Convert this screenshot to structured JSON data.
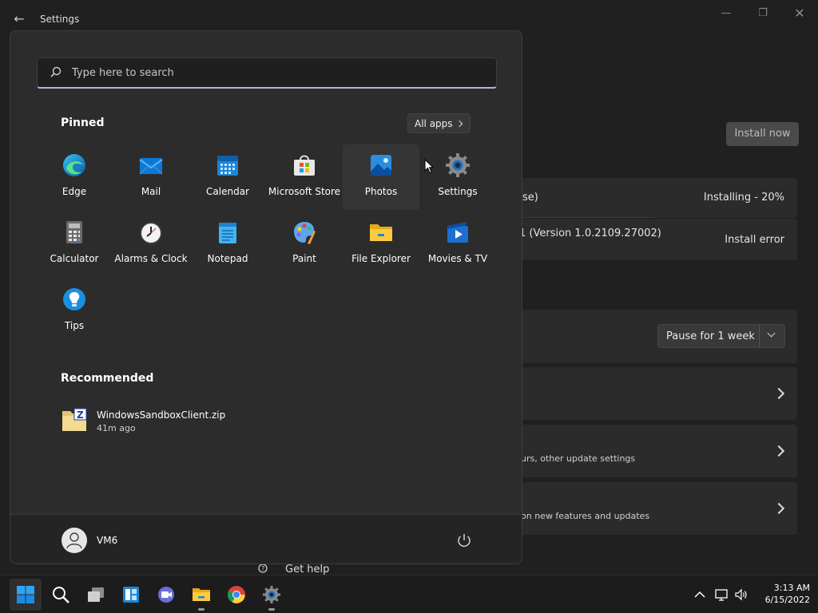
{
  "window": {
    "title": "Settings",
    "back_icon": "back-arrow-icon"
  },
  "updates": {
    "install_now": "Install now",
    "item1_name": "se)",
    "item1_status": "Installing - 20%",
    "item1_progress": 0.2,
    "item2_name": "1 (Version 1.0.2109.27002)",
    "item2_status": "Install error",
    "pause_option": "Pause for 1 week",
    "row3_sub": "urs, other update settings",
    "row4_sub": "on new features and updates",
    "get_help": "Get help"
  },
  "start": {
    "search_placeholder": "Type here to search",
    "pinned_title": "Pinned",
    "all_apps": "All apps",
    "apps": [
      {
        "name": "Edge",
        "icon": "edge-icon"
      },
      {
        "name": "Mail",
        "icon": "mail-icon"
      },
      {
        "name": "Calendar",
        "icon": "calendar-icon"
      },
      {
        "name": "Microsoft Store",
        "icon": "store-icon"
      },
      {
        "name": "Photos",
        "icon": "photos-icon"
      },
      {
        "name": "Settings",
        "icon": "gear-icon"
      },
      {
        "name": "Calculator",
        "icon": "calculator-icon"
      },
      {
        "name": "Alarms & Clock",
        "icon": "clock-icon"
      },
      {
        "name": "Notepad",
        "icon": "notepad-icon"
      },
      {
        "name": "Paint",
        "icon": "paint-icon"
      },
      {
        "name": "File Explorer",
        "icon": "folder-icon"
      },
      {
        "name": "Movies & TV",
        "icon": "movies-icon"
      },
      {
        "name": "Tips",
        "icon": "lightbulb-icon"
      }
    ],
    "recommended_title": "Recommended",
    "recommended": [
      {
        "name": "WindowsSandboxClient.zip",
        "time": "41m ago",
        "icon": "zip-archive-icon"
      }
    ],
    "user": "VM6"
  },
  "taskbar": {
    "time": "3:13 AM",
    "date": "6/15/2022"
  },
  "colors": {
    "accent": "#60cdff",
    "search_underline": "#c9a8e6",
    "menu_bg": "#2c2c2c"
  }
}
